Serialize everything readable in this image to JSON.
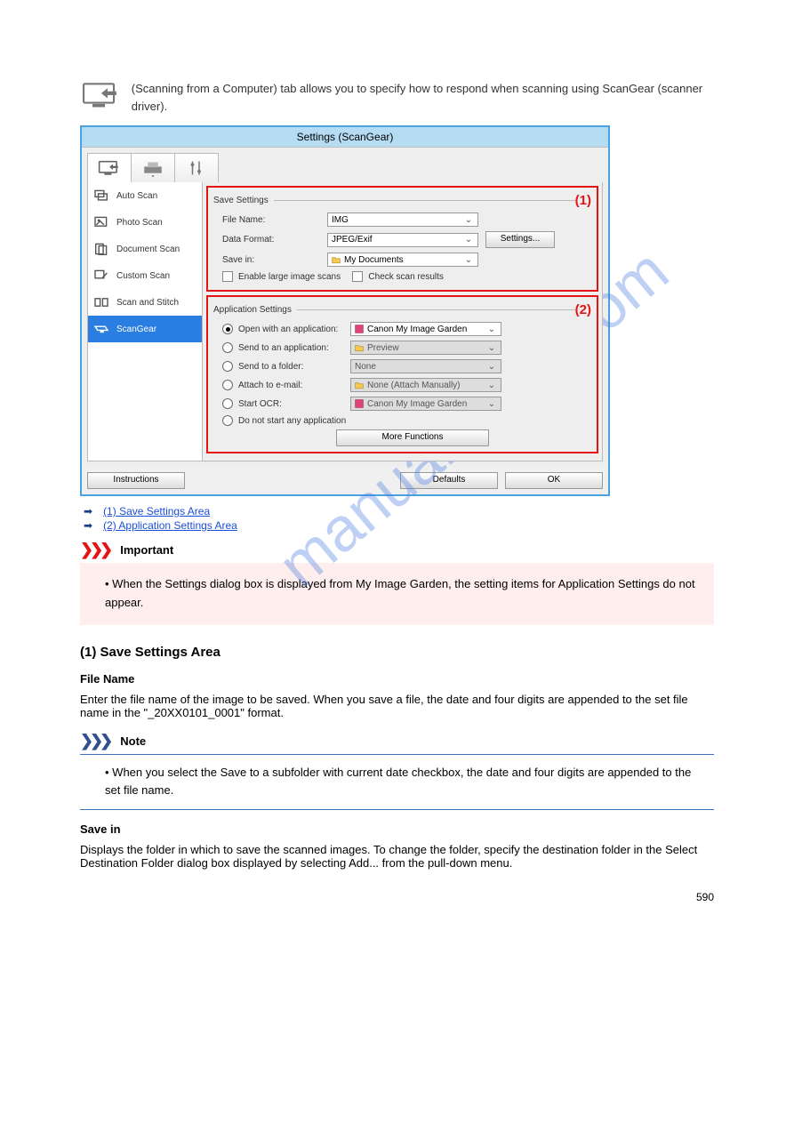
{
  "intro_icon_label": "Scanning from Computer",
  "intro_text": " (Scanning from a Computer) tab allows you to specify how to respond when scanning using ScanGear (scanner driver).",
  "dialog": {
    "title": "Settings (ScanGear)",
    "tabs": [
      "scan-from-computer",
      "scan-to-computer",
      "general-settings"
    ],
    "sidebar": [
      {
        "label": "Auto Scan",
        "selected": false
      },
      {
        "label": "Photo Scan",
        "selected": false
      },
      {
        "label": "Document Scan",
        "selected": false
      },
      {
        "label": "Custom Scan",
        "selected": false
      },
      {
        "label": "Scan and Stitch",
        "selected": false
      },
      {
        "label": "ScanGear",
        "selected": true
      }
    ],
    "save": {
      "section_label": "Save Settings",
      "num": "(1)",
      "file_name_label": "File Name:",
      "file_name_value": "IMG",
      "data_format_label": "Data Format:",
      "data_format_value": "JPEG/Exif",
      "settings_btn": "Settings...",
      "save_in_label": "Save in:",
      "save_in_value": "My Documents",
      "chk_large": "Enable large image scans",
      "chk_check": "Check scan results"
    },
    "app": {
      "section_label": "Application Settings",
      "num": "(2)",
      "opts": [
        {
          "label": "Open with an application:",
          "value": "Canon My Image Garden",
          "sel": true,
          "enabled": true,
          "icon": "app"
        },
        {
          "label": "Send to an application:",
          "value": "Preview",
          "sel": false,
          "enabled": false,
          "icon": "folder"
        },
        {
          "label": "Send to a folder:",
          "value": "None",
          "sel": false,
          "enabled": false,
          "icon": ""
        },
        {
          "label": "Attach to e-mail:",
          "value": "None (Attach Manually)",
          "sel": false,
          "enabled": false,
          "icon": "folder"
        },
        {
          "label": "Start OCR:",
          "value": "Canon My Image Garden",
          "sel": false,
          "enabled": false,
          "icon": "app"
        },
        {
          "label": "Do not start any application",
          "value": "",
          "sel": false,
          "enabled": false,
          "icon": ""
        }
      ],
      "more_btn": "More Functions"
    },
    "footer": {
      "instructions": "Instructions",
      "defaults": "Defaults",
      "ok": "OK"
    }
  },
  "links": {
    "l1": "(1) Save Settings Area",
    "l2": "(2) Application Settings Area"
  },
  "important": {
    "head": "Important",
    "body": "When the Settings dialog box is displayed from My Image Garden, the setting items for Application Settings do not appear."
  },
  "sec1_head": "(1) Save Settings Area",
  "file_name_term": "File Name",
  "file_name_desc": "Enter the file name of the image to be saved. When you save a file, the date and four digits are appended to the set file name in the \"_20XX0101_0001\" format.",
  "note": {
    "head": "Note",
    "body": "When you select the Save to a subfolder with current date checkbox, the date and four digits are appended to the set file name."
  },
  "save_in_term": "Save in",
  "save_in_desc": "Displays the folder in which to save the scanned images. To change the folder, specify the destination folder in the Select Destination Folder dialog box displayed by selecting Add... from the pull-down menu.",
  "page": "590"
}
